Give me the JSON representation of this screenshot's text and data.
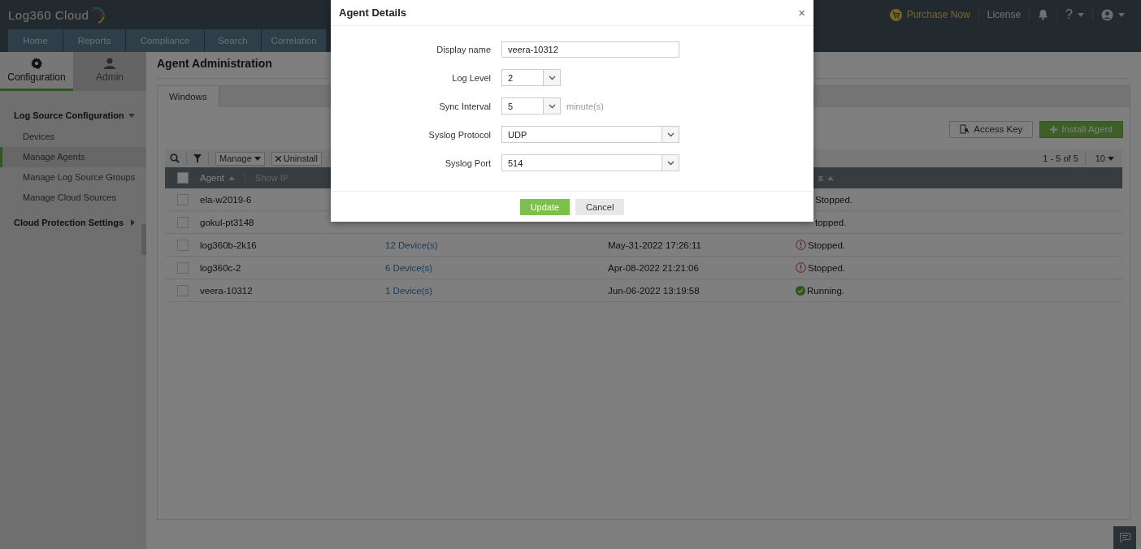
{
  "brand": {
    "name": "Log360 Cloud"
  },
  "top_links": [
    {
      "kind": "purchase",
      "label": "Purchase Now"
    },
    {
      "kind": "link",
      "label": "License"
    },
    {
      "kind": "bell"
    },
    {
      "kind": "help",
      "label": "?"
    },
    {
      "kind": "user"
    }
  ],
  "nav_tabs": [
    {
      "label": "Home"
    },
    {
      "label": "Reports"
    },
    {
      "label": "Compliance"
    },
    {
      "label": "Search"
    },
    {
      "label": "Correlation"
    }
  ],
  "sidebar": {
    "tabs": [
      {
        "label": "Configuration",
        "kind": "gear",
        "selected": true
      },
      {
        "label": "Admin",
        "kind": "person",
        "selected": false
      }
    ],
    "items": [
      {
        "label": "Log Source Configuration",
        "expanded": true,
        "children": [
          {
            "label": "Devices",
            "selected": false
          },
          {
            "label": "Manage Agents",
            "selected": true
          },
          {
            "label": "Manage Log Source Groups",
            "selected": false
          },
          {
            "label": "Manage Cloud Sources",
            "selected": false
          }
        ]
      },
      {
        "label": "Cloud Protection Settings",
        "expanded": false
      }
    ]
  },
  "page_title": "Agent Administration",
  "os_tabs": [
    {
      "label": "Windows",
      "selected": true
    }
  ],
  "actions": [
    {
      "kind": "secondary",
      "label": "Access Key"
    },
    {
      "kind": "primary",
      "label": "Install Agent"
    }
  ],
  "toolbar": {
    "buttons": [
      {
        "kind": "menu",
        "label": "Manage"
      },
      {
        "kind": "close",
        "label": "Uninstall"
      }
    ],
    "pagination": "1 - 5 of 5",
    "page_size": "10"
  },
  "table": {
    "all_checked": false,
    "columns": [
      {
        "label": "Agent"
      },
      {
        "label": "Show IP"
      },
      {
        "label": "s"
      }
    ],
    "rows": [
      {
        "agent": "ela-w2019-6",
        "checked": false,
        "status": "Stopped."
      },
      {
        "agent": "gokul-pt3148",
        "checked": false,
        "status": "topped."
      },
      {
        "agent": "log360b-2k16",
        "checked": false,
        "devices": "12 Device(s)",
        "last_seen": "May-31-2022 17:26:11",
        "kind": "stopped",
        "status": "Stopped."
      },
      {
        "agent": "log360c-2",
        "checked": false,
        "devices": "6 Device(s)",
        "last_seen": "Apr-08-2022 21:21:06",
        "kind": "stopped",
        "status": "Stopped."
      },
      {
        "agent": "veera-10312",
        "checked": false,
        "devices": "1 Device(s)",
        "last_seen": "Jun-06-2022 13:19:58",
        "kind": "running",
        "status": "Running."
      }
    ]
  },
  "dialog": {
    "title": "Agent Details",
    "close": "×",
    "fields": [
      {
        "label": "Display name",
        "kind": "text",
        "value": "veera-10312"
      },
      {
        "label": "Log Level",
        "kind": "select_small",
        "value": "2"
      },
      {
        "label": "Sync Interval",
        "kind": "select_small",
        "value": "5",
        "unit": "minute(s)"
      },
      {
        "label": "Syslog Protocol",
        "kind": "select",
        "value": "UDP"
      },
      {
        "label": "Syslog Port",
        "kind": "select",
        "value": "514"
      }
    ],
    "buttons": [
      {
        "kind": "primary",
        "label": "Update"
      },
      {
        "kind": "secondary",
        "label": "Cancel"
      }
    ]
  }
}
